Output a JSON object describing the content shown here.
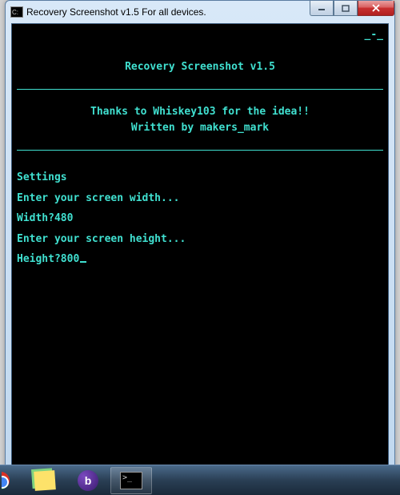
{
  "window": {
    "title": "Recovery Screenshot v1.5 For all devices."
  },
  "console": {
    "top_dashes": "_-_",
    "header_title": "Recovery Screenshot v1.5",
    "thanks_line": "Thanks to Whiskey103 for the idea!!",
    "written_line": "Written by makers_mark",
    "settings_label": "Settings",
    "prompt_width": "Enter your screen width...",
    "width_prompt": "Width?",
    "width_value": "480",
    "prompt_height": "Enter your screen height...",
    "height_prompt": "Height?",
    "height_value": "800"
  },
  "taskbar": {
    "items": [
      {
        "name": "chrome"
      },
      {
        "name": "sticky-notes"
      },
      {
        "name": "bittorrent"
      },
      {
        "name": "command-prompt"
      }
    ]
  }
}
